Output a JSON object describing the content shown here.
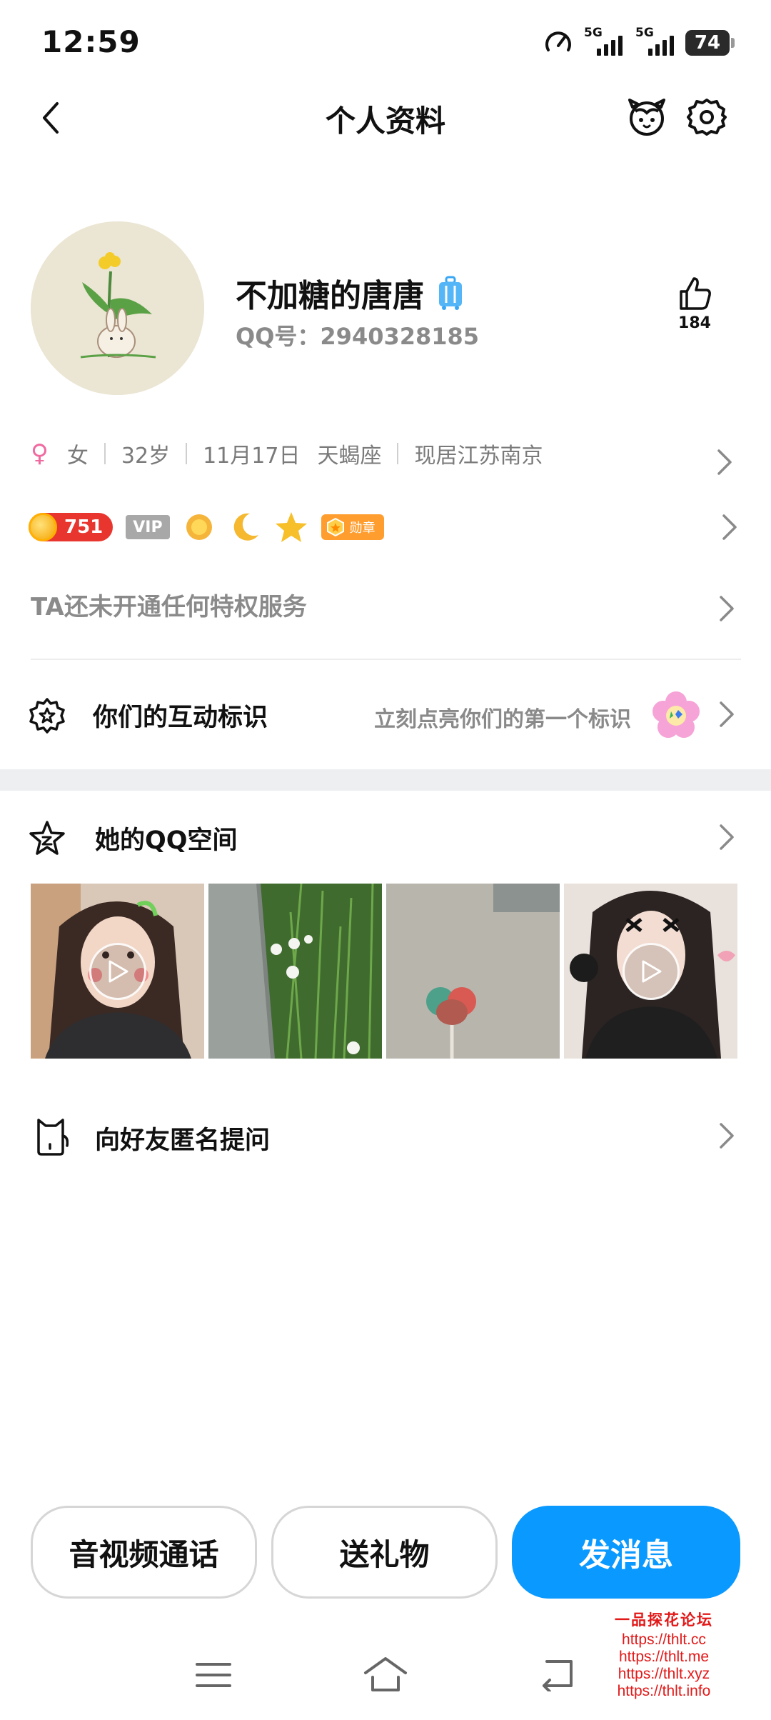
{
  "status_bar": {
    "time": "12:59",
    "network1": "5G",
    "network2": "5G",
    "battery": "74"
  },
  "header": {
    "title": "个人资料"
  },
  "profile": {
    "nickname": "不加糖的唐唐",
    "qq_number": "QQ号：2940328185",
    "like_count": "184"
  },
  "info": {
    "gender": "女",
    "age": "32岁",
    "birthday": "11月17日",
    "zodiac": "天蝎座",
    "location": "现居江苏南京"
  },
  "badges": {
    "level": "751",
    "vip": "VIP",
    "medal": "勋章"
  },
  "privilege": {
    "text": "TA还未开通任何特权服务"
  },
  "interaction": {
    "label": "你们的互动标识",
    "hint": "立刻点亮你们的第一个标识"
  },
  "qzone": {
    "label": "她的QQ空间"
  },
  "anonymous": {
    "label": "向好友匿名提问"
  },
  "actions": {
    "call": "音视频通话",
    "gift": "送礼物",
    "message": "发消息"
  },
  "watermark": {
    "title": "一品探花论坛",
    "links": [
      "https://thlt.cc",
      "https://thlt.me",
      "https://thlt.xyz",
      "https://thlt.info"
    ]
  },
  "colors": {
    "primary": "#0a99ff",
    "female": "#f06aa0",
    "level_badge": "#e8362e",
    "watermark": "#e31818"
  }
}
